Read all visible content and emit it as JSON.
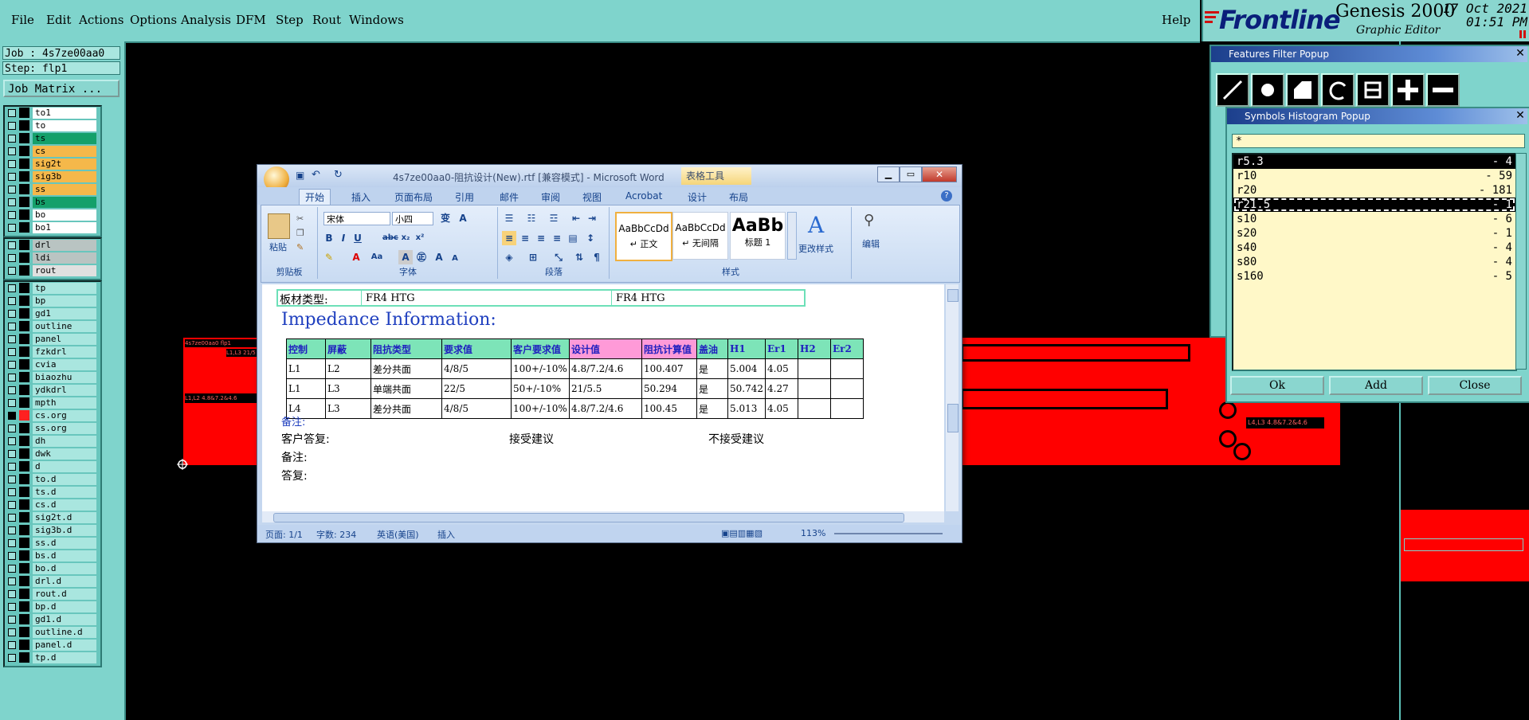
{
  "menubar": {
    "items": [
      "File",
      "Edit",
      "Actions",
      "Options",
      "Analysis",
      "DFM",
      "Step",
      "Rout",
      "Windows"
    ],
    "help": "Help"
  },
  "brand": {
    "logo": "Frontline",
    "product": "Genesis 2000",
    "subtitle": "Graphic Editor",
    "date": "17 Oct 2021",
    "time": "01:51 PM"
  },
  "job": {
    "job_line": "Job : 4s7ze00aa0",
    "step_line": "Step: flp1",
    "matrix_button": "Job Matrix ..."
  },
  "layers": {
    "group1": [
      {
        "name": "to1",
        "color": "#ffffff"
      },
      {
        "name": "to",
        "color": "#ffffff"
      },
      {
        "name": "ts",
        "color": "#14a06a"
      },
      {
        "name": "cs",
        "color": "#f5b84a"
      },
      {
        "name": "sig2t",
        "color": "#f5b84a"
      },
      {
        "name": "sig3b",
        "color": "#f5b84a"
      },
      {
        "name": "ss",
        "color": "#f5b84a"
      },
      {
        "name": "bs",
        "color": "#14a06a"
      },
      {
        "name": "bo",
        "color": "#ffffff"
      },
      {
        "name": "bo1",
        "color": "#ffffff"
      }
    ],
    "group2": [
      {
        "name": "drl",
        "color": "#b9c4c2"
      },
      {
        "name": "ldi",
        "color": "#b9c4c2"
      },
      {
        "name": "rout",
        "color": "#e0e0e0"
      }
    ],
    "group3": [
      "tp",
      "bp",
      "gd1",
      "outline",
      "panel",
      "fzkdrl",
      "cvia",
      "biaozhu",
      "ydkdrl",
      "mpth",
      "cs.org",
      "ss.org",
      "dh",
      "dwk",
      "d",
      "to.d",
      "ts.d",
      "cs.d",
      "sig2t.d",
      "sig3b.d",
      "ss.d",
      "bs.d",
      "bo.d",
      "drl.d",
      "rout.d",
      "bp.d",
      "gd1.d",
      "outline.d",
      "panel.d",
      "tp.d"
    ],
    "active_layer": "cs.org"
  },
  "word": {
    "title": "4s7ze00aa0-阻抗设计(New).rtf [兼容模式] - Microsoft Word",
    "context_tab": "表格工具",
    "tabs": [
      "开始",
      "插入",
      "页面布局",
      "引用",
      "邮件",
      "审阅",
      "视图",
      "Acrobat",
      "设计",
      "布局"
    ],
    "font_name": "宋体",
    "font_size": "小四",
    "groups": [
      "剪贴板",
      "字体",
      "段落",
      "样式",
      "编辑"
    ],
    "paste_label": "粘贴",
    "styles": [
      {
        "sample": "AaBbCcDd",
        "name": "↵ 正文"
      },
      {
        "sample": "AaBbCcDd",
        "name": "↵ 无间隔"
      },
      {
        "sample": "AaBb",
        "name": "标题 1"
      }
    ],
    "change_styles": "更改样式",
    "edit_label": "编辑",
    "board_label": "板材类型:",
    "board_value1": "FR4 HTG",
    "board_value2": "FR4 HTG",
    "heading": "Impedance Information:",
    "table_header": [
      "控制",
      "屏蔽",
      "阻抗类型",
      "要求值",
      "客户要求值",
      "设计值",
      "阻抗计算值",
      "盖油",
      "H1",
      "Er1",
      "H2",
      "Er2"
    ],
    "table_rows": [
      [
        "L1",
        "L2",
        "差分共面",
        "4/8/5",
        "100+/-10%",
        "4.8/7.2/4.6",
        "100.407",
        "是",
        "5.004",
        "4.05",
        "",
        ""
      ],
      [
        "L1",
        "L3",
        "单端共面",
        "22/5",
        "50+/-10%",
        "21/5.5",
        "50.294",
        "是",
        "50.742",
        "4.27",
        "",
        ""
      ],
      [
        "L4",
        "L3",
        "差分共面",
        "4/8/5",
        "100+/-10%",
        "4.8/7.2/4.6",
        "100.45",
        "是",
        "5.013",
        "4.05",
        "",
        ""
      ]
    ],
    "note1": "备注:",
    "reply": "客户答复:",
    "accept": "接受建议",
    "reject": "不接受建议",
    "note2": "备注:",
    "answer": "答复:",
    "status_page": "页面: 1/1",
    "status_words": "字数: 234",
    "status_lang": "英语(美国)",
    "status_mode": "插入",
    "zoom": "113%"
  },
  "features_popup": {
    "title": "Features Filter Popup"
  },
  "histogram_popup": {
    "title": "Symbols Histogram Popup",
    "filter": "*",
    "rows": [
      {
        "sym": "r5.3",
        "count": "- 4",
        "state": "sel"
      },
      {
        "sym": "r10",
        "count": "- 59",
        "state": ""
      },
      {
        "sym": "r20",
        "count": "- 181",
        "state": ""
      },
      {
        "sym": "r21.5",
        "count": "- 1",
        "state": "dash"
      },
      {
        "sym": "s10",
        "count": "- 6",
        "state": ""
      },
      {
        "sym": "s20",
        "count": "- 1",
        "state": ""
      },
      {
        "sym": "s40",
        "count": "- 4",
        "state": ""
      },
      {
        "sym": "s80",
        "count": "- 4",
        "state": ""
      },
      {
        "sym": "s160",
        "count": "- 5",
        "state": ""
      }
    ],
    "ok": "Ok",
    "add": "Add",
    "close": "Close"
  },
  "canvas": {
    "left_board_label": "4s7ze00aa0 flp1",
    "left_label2": "L1,L3 21/5",
    "left_label3": "L1,L2 4.8&7.2&4.6",
    "right_label": "L4,L3 4.8&7.2&4.6"
  },
  "colors": {
    "panel": "#7fd4cc",
    "feature": "#ff0000",
    "brand_blue": "#0a1f7a"
  }
}
